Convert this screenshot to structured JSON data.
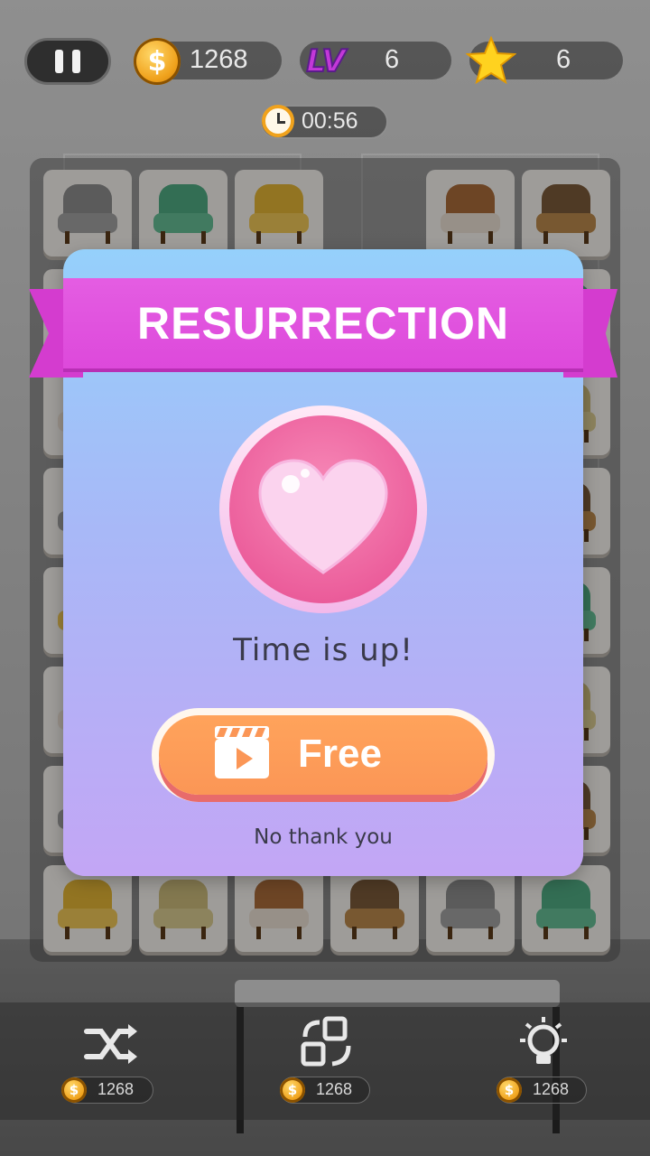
{
  "hud": {
    "coins": "1268",
    "level_badge": "LV",
    "level": "6",
    "stars": "6",
    "timer": "00:56"
  },
  "dialog": {
    "title": "RESURRECTION",
    "message": "Time is up!",
    "free_button_label": "Free",
    "decline_label": "No thank you"
  },
  "tools": [
    {
      "name": "shuffle",
      "cost": "1268"
    },
    {
      "name": "swap",
      "cost": "1268"
    },
    {
      "name": "hint",
      "cost": "1268"
    }
  ],
  "colors": {
    "ribbon": "#dd49db",
    "dialog_top": "#95d0fb",
    "dialog_bottom": "#c3a6f5",
    "free_button": "#fb9656",
    "heart": "#ec5f9c"
  }
}
